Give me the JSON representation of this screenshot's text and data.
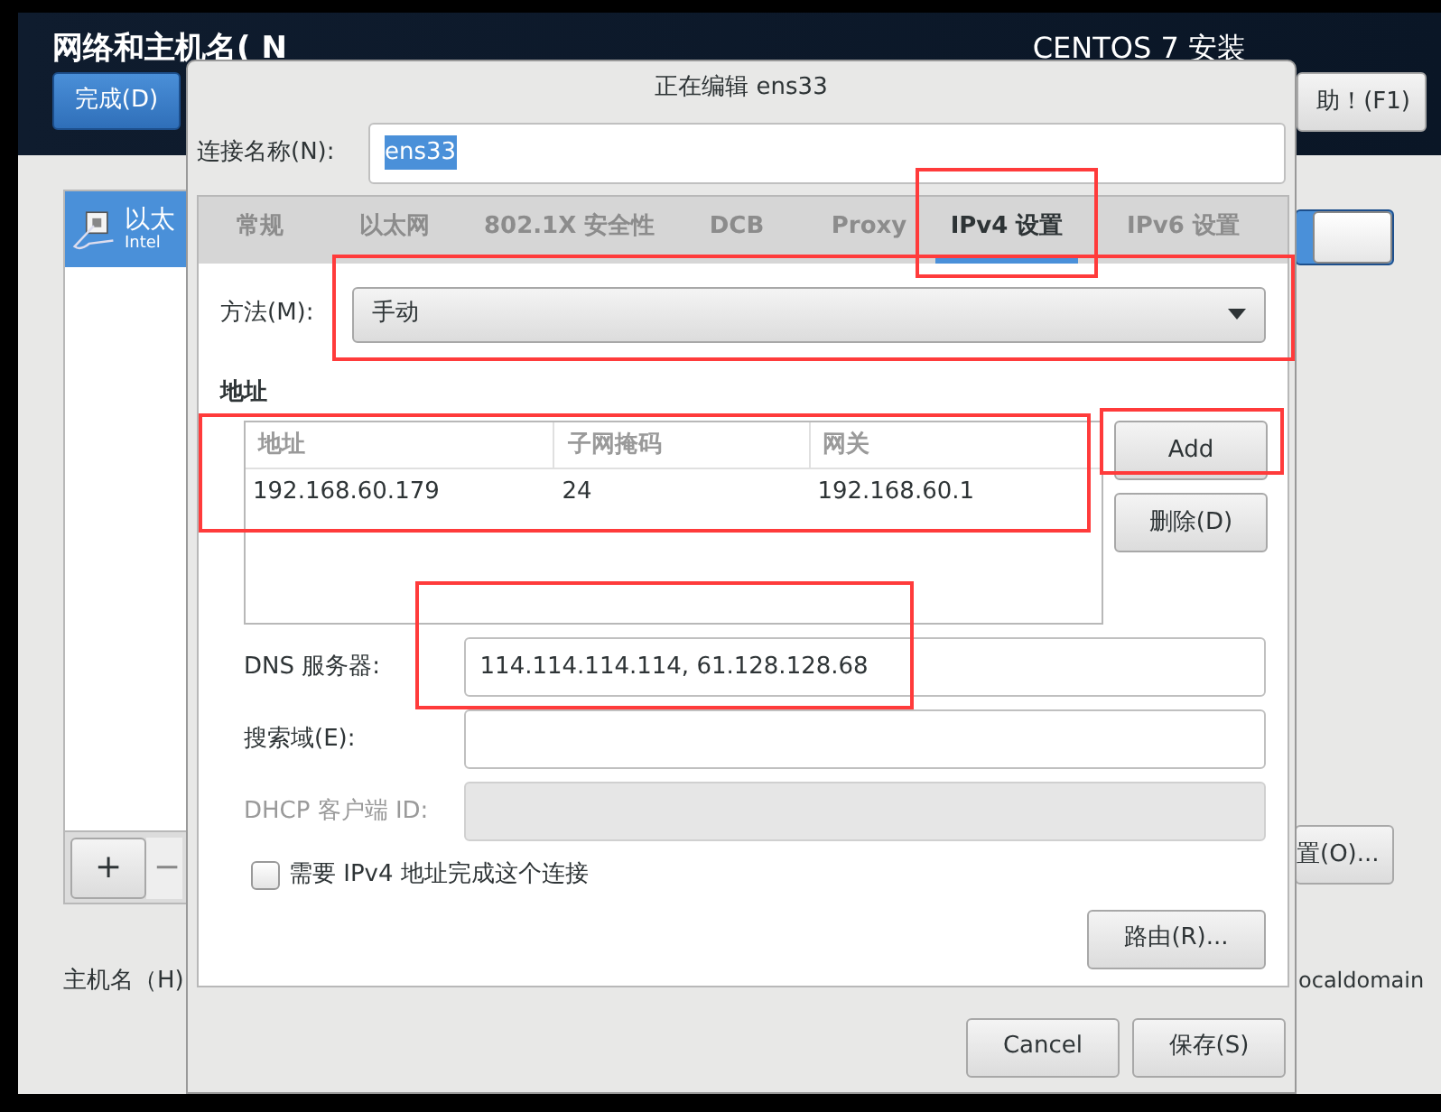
{
  "installer": {
    "title": "网络和主机名( N",
    "done_button": "完成(D)",
    "product": "CENTOS 7 安装",
    "help_button": "助！(F1)"
  },
  "devices": [
    {
      "name": "以太",
      "detail": "Intel",
      "selected": true
    }
  ],
  "device_toolbar": {
    "add": "+",
    "remove": "−"
  },
  "device_switch": {
    "on": true
  },
  "configure_button": "置(O)...",
  "hostname": {
    "label": "主机名（H)",
    "value": "ocaldomain"
  },
  "dialog": {
    "title": "正在编辑 ens33",
    "connection_name": {
      "label": "连接名称(N):",
      "value": "ens33"
    },
    "tabs": [
      {
        "label": "常规",
        "selected": false
      },
      {
        "label": "以太网",
        "selected": false
      },
      {
        "label": "802.1X 安全性",
        "selected": false
      },
      {
        "label": "DCB",
        "selected": false
      },
      {
        "label": "Proxy",
        "selected": false
      },
      {
        "label": "IPv4 设置",
        "selected": true
      },
      {
        "label": "IPv6 设置",
        "selected": false
      }
    ],
    "method": {
      "label": "方法(M):",
      "value": "手动"
    },
    "addresses": {
      "title": "地址",
      "columns": [
        "地址",
        "子网掩码",
        "网关"
      ],
      "rows": [
        [
          "192.168.60.179",
          "24",
          "192.168.60.1"
        ]
      ],
      "buttons": [
        "Add",
        "删除(D)"
      ]
    },
    "fields": [
      {
        "label": "DNS 服务器:",
        "value": "114.114.114.114, 61.128.128.68",
        "disabled": false
      },
      {
        "label": "搜索域(E):",
        "disabled": false
      },
      {
        "label": "DHCP 客户端 ID:",
        "disabled": true
      }
    ],
    "require_ipv4": {
      "label": "需要 IPv4 地址完成这个连接",
      "checked": false
    },
    "routes_button": "路由(R)...",
    "buttons": [
      "Cancel",
      "保存(S)"
    ]
  }
}
